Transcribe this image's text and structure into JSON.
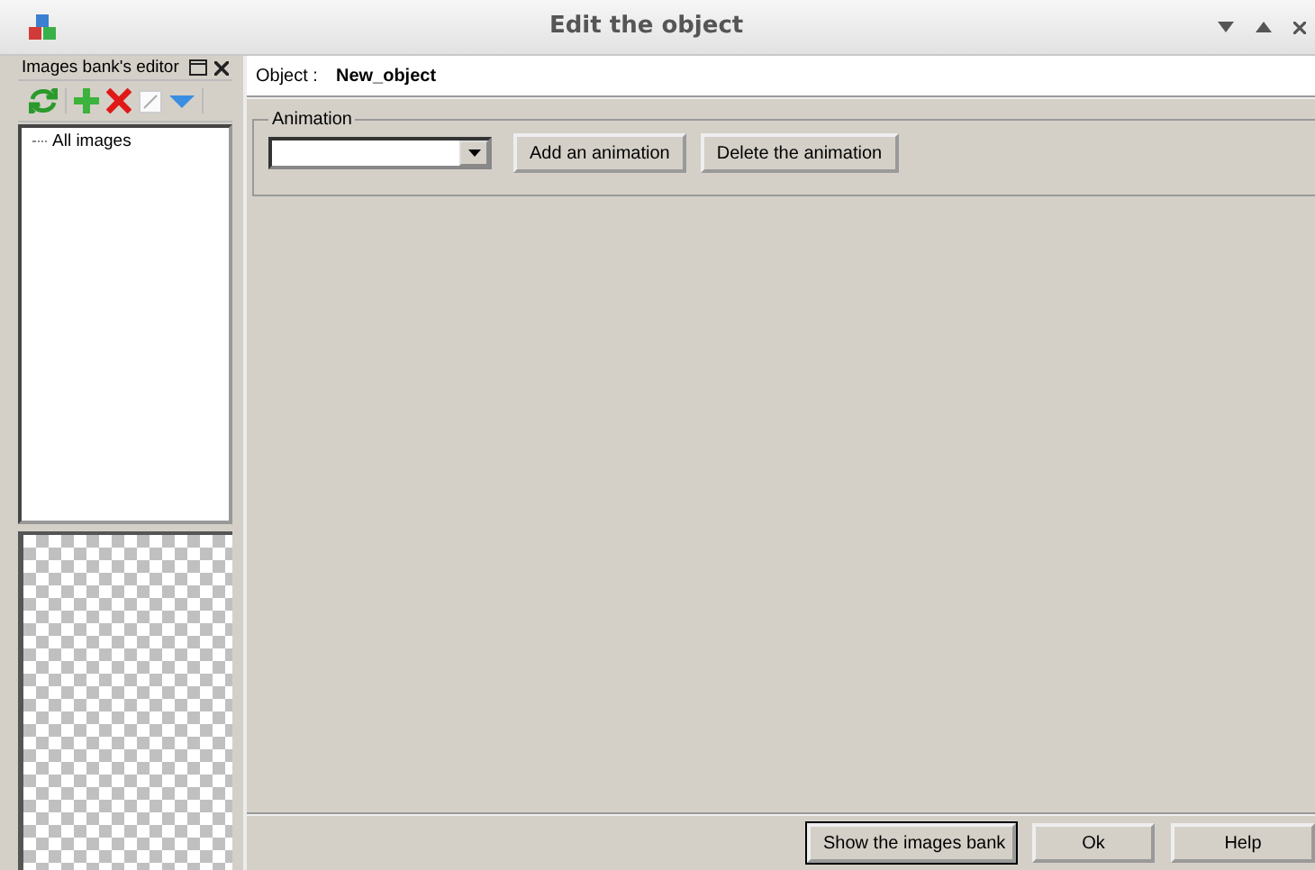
{
  "window": {
    "title": "Edit the object"
  },
  "images_bank": {
    "title": "Images bank's editor",
    "tree": [
      {
        "label": "All images"
      }
    ]
  },
  "object": {
    "label": "Object :",
    "name": "New_object"
  },
  "animation": {
    "title": "Animation",
    "buttons": [
      "Add an animation",
      "Delete the animation"
    ]
  },
  "footer_buttons": [
    "Show the images bank",
    "Ok",
    "Help"
  ]
}
